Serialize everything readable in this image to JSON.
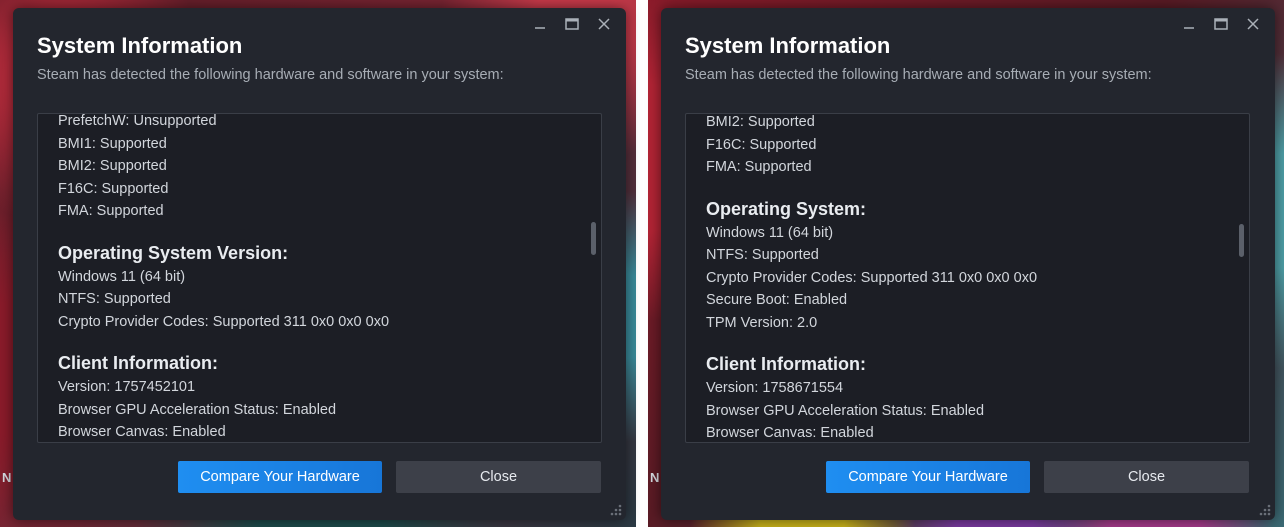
{
  "colors": {
    "dialog_bg": "#23262e",
    "panel_bg": "#1c1e25",
    "primary_button": "#1a85ee",
    "secondary_button": "#3d4049"
  },
  "background_edge_letters": [
    "N",
    "N"
  ],
  "dialogs": [
    {
      "title": "System Information",
      "subtitle": "Steam has detected the following hardware and software in your system:",
      "lines_top": [
        "PrefetchW: Unsupported",
        "BMI1: Supported",
        "BMI2: Supported",
        "F16C: Supported",
        "FMA: Supported"
      ],
      "section1_title": "Operating System Version:",
      "section1_lines": [
        "Windows 11 (64 bit)",
        "NTFS: Supported",
        "Crypto Provider Codes: Supported 311 0x0 0x0 0x0"
      ],
      "section2_title": "Client Information:",
      "section2_lines": [
        "Version: 1757452101",
        "Browser GPU Acceleration Status: Enabled",
        "Browser Canvas: Enabled"
      ],
      "compare_button": "Compare Your Hardware",
      "close_button": "Close"
    },
    {
      "title": "System Information",
      "subtitle": "Steam has detected the following hardware and software in your system:",
      "lines_top": [
        "BMI2: Supported",
        "F16C: Supported",
        "FMA: Supported"
      ],
      "section1_title": "Operating System:",
      "section1_lines": [
        "Windows 11 (64 bit)",
        "NTFS: Supported",
        "Crypto Provider Codes: Supported 311 0x0 0x0 0x0",
        "Secure Boot: Enabled",
        "TPM Version: 2.0"
      ],
      "section2_title": "Client Information:",
      "section2_lines": [
        "Version: 1758671554",
        "Browser GPU Acceleration Status: Enabled",
        "Browser Canvas: Enabled"
      ],
      "compare_button": "Compare Your Hardware",
      "close_button": "Close"
    }
  ]
}
